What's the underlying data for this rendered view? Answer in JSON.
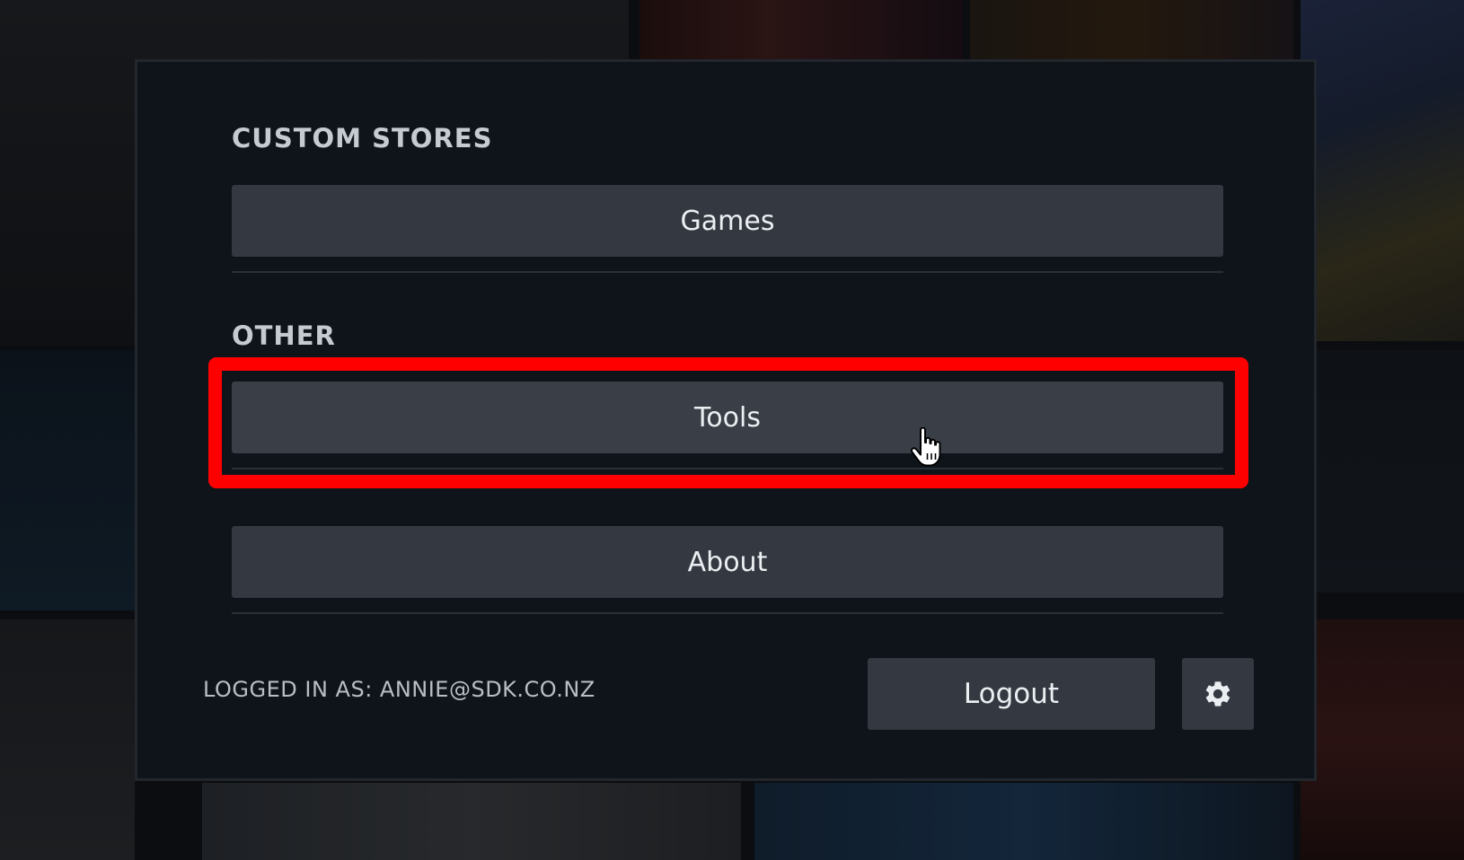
{
  "sections": {
    "custom_stores": {
      "title": "CUSTOM STORES",
      "items": [
        {
          "label": "Games"
        }
      ]
    },
    "other": {
      "title": "OTHER",
      "items": [
        {
          "label": "Tools",
          "highlighted": true,
          "hovered": true
        },
        {
          "label": "About"
        }
      ]
    }
  },
  "footer": {
    "login_status": "LOGGED IN AS: ANNIE@SDK.CO.NZ",
    "logout_label": "Logout",
    "settings_icon": "gear-icon"
  },
  "colors": {
    "highlight": "#ff0000",
    "modal_background": "#0f141b",
    "button_background": "#343941",
    "text": "#eceff2"
  },
  "cursor": "pointer-hand"
}
